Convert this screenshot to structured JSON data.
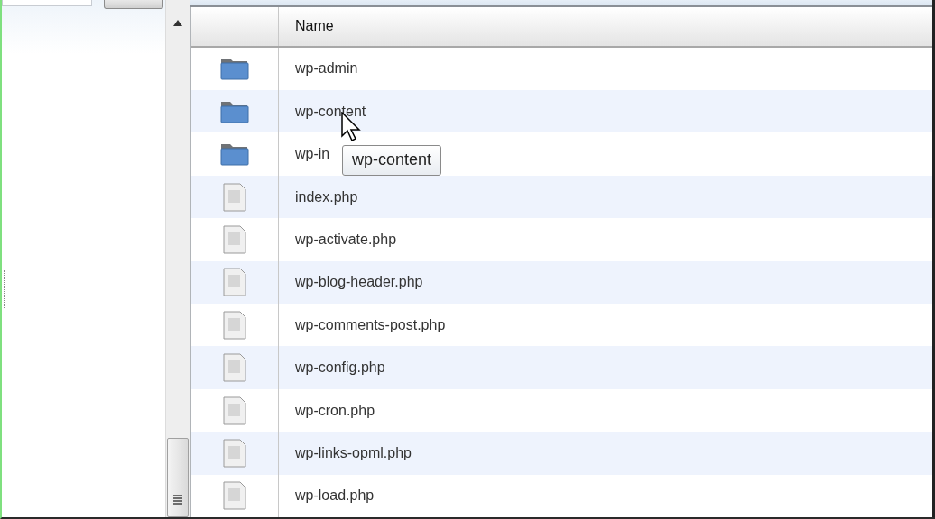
{
  "table": {
    "columns": [
      {},
      {
        "label": "Name"
      }
    ],
    "rows": [
      {
        "kind": "folder",
        "name": "wp-admin"
      },
      {
        "kind": "folder",
        "name": "wp-content"
      },
      {
        "kind": "folder",
        "name": "wp-in"
      },
      {
        "kind": "file",
        "name": "index.php"
      },
      {
        "kind": "file",
        "name": "wp-activate.php"
      },
      {
        "kind": "file",
        "name": "wp-blog-header.php"
      },
      {
        "kind": "file",
        "name": "wp-comments-post.php"
      },
      {
        "kind": "file",
        "name": "wp-config.php"
      },
      {
        "kind": "file",
        "name": "wp-cron.php"
      },
      {
        "kind": "file",
        "name": "wp-links-opml.php"
      },
      {
        "kind": "file",
        "name": "wp-load.php"
      }
    ]
  },
  "tooltip": {
    "text": "wp-content"
  }
}
